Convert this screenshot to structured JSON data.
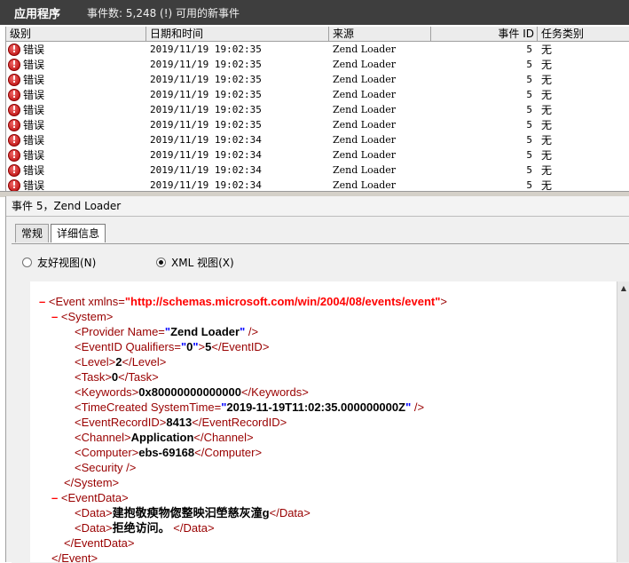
{
  "header": {
    "app_title": "应用程序",
    "event_count": "事件数: 5,248 (!) 可用的新事件"
  },
  "grid": {
    "columns": [
      "级别",
      "日期和时间",
      "来源",
      "事件 ID",
      "任务类别"
    ],
    "rows": [
      {
        "level": "错误",
        "datetime": "2019/11/19 19:02:35",
        "source": "Zend Loader",
        "event_id": "5",
        "category": "无"
      },
      {
        "level": "错误",
        "datetime": "2019/11/19 19:02:35",
        "source": "Zend Loader",
        "event_id": "5",
        "category": "无"
      },
      {
        "level": "错误",
        "datetime": "2019/11/19 19:02:35",
        "source": "Zend Loader",
        "event_id": "5",
        "category": "无"
      },
      {
        "level": "错误",
        "datetime": "2019/11/19 19:02:35",
        "source": "Zend Loader",
        "event_id": "5",
        "category": "无"
      },
      {
        "level": "错误",
        "datetime": "2019/11/19 19:02:35",
        "source": "Zend Loader",
        "event_id": "5",
        "category": "无"
      },
      {
        "level": "错误",
        "datetime": "2019/11/19 19:02:35",
        "source": "Zend Loader",
        "event_id": "5",
        "category": "无"
      },
      {
        "level": "错误",
        "datetime": "2019/11/19 19:02:34",
        "source": "Zend Loader",
        "event_id": "5",
        "category": "无"
      },
      {
        "level": "错误",
        "datetime": "2019/11/19 19:02:34",
        "source": "Zend Loader",
        "event_id": "5",
        "category": "无"
      },
      {
        "level": "错误",
        "datetime": "2019/11/19 19:02:34",
        "source": "Zend Loader",
        "event_id": "5",
        "category": "无"
      },
      {
        "level": "错误",
        "datetime": "2019/11/19 19:02:34",
        "source": "Zend Loader",
        "event_id": "5",
        "category": "无"
      }
    ]
  },
  "details": {
    "title": "事件 5，Zend Loader",
    "tabs": [
      "常规",
      "详细信息"
    ],
    "friendly_view": "友好视图(N)",
    "xml_view": "XML 视图(X)"
  },
  "xml": {
    "namespace": "http://schemas.microsoft.com/win/2004/08/events/event",
    "provider_name": "Zend Loader",
    "qualifiers": "0",
    "event_id": "5",
    "level": "2",
    "task": "0",
    "keywords": "0x80000000000000",
    "system_time": "2019-11-19T11:02:35.000000000Z",
    "record_id": "8413",
    "channel": "Application",
    "computer": "ebs-69168",
    "data1": "建抱敬瘐物偬整映汩塋慈灰潼g",
    "data2": "拒绝访问。"
  }
}
